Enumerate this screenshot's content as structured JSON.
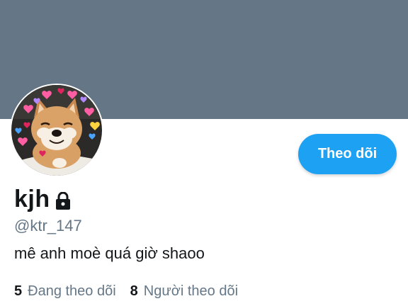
{
  "header": {
    "banner_color": "#657786"
  },
  "profile": {
    "display_name": "kjh",
    "handle": "@ktr_147",
    "bio": "mê anh moè quá giờ shaoo",
    "protected_icon": "lock-icon",
    "avatar_icon": "shiba-dog-with-hearts"
  },
  "actions": {
    "follow_label": "Theo dõi",
    "accent_color": "#1da1f2"
  },
  "stats": {
    "following_count": "5",
    "following_label": "Đang theo dõi",
    "followers_count": "8",
    "followers_label": "Người theo dõi"
  }
}
